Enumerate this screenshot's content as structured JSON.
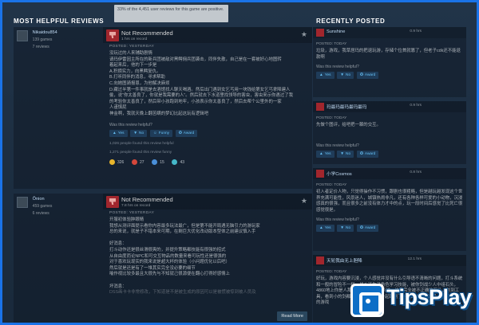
{
  "left_title": "MOST HELPFUL REVIEWS",
  "right_title": "RECENTLY POSTED",
  "tooltip": "33% of the 4,451 user reviews for this game are positive.",
  "reviews": [
    {
      "author": "Nikaidou854",
      "games": "139 games",
      "review_count": "7 reviews",
      "recommendation": "Not Recommended",
      "hours": "1 hrs on record",
      "posted": "POSTED: YESTERDAY",
      "lines": [
        "没玩过的人来辅助剧情",
        "请玛伊雷因主所在的新兵团被敌对黑鳄佣兵团袭击，同伴失散，自己是在一套被好心地图转",
        "着起来后，他的下一步是",
        "A.积攒实力，向黑鳄复仇。",
        "B.打听同伴的消息，寻求帮助",
        "C.向她图骑报恩，为他解决麻烦",
        "D.藏过半第一件事就是去酒馆找人聊天喝酒。然后出门遇到女乞丐用一块钱给第女乞丐拿降建人",
        "偷，说“你太善良了，你就是我需要的人”。然后就去下水道里找领导的害虫，害虫来示你遇过了我",
        "的考验你太善良了，然后带小孩跑到地牢，小孩表示你太善良了，然后去帮个公里外的一家",
        "人谨慎屁",
        "神金啊，我就天晚上翻苦瞒的梦幻比起这玩有逻辑吧"
      ],
      "helpful_q": "Was this review helpful?",
      "yes": "Yes",
      "no": "No",
      "funny": "Funny",
      "award": "Award",
      "helpful_count": "1,026 people found this review helpful",
      "funny_count": "1,271 people found this review funny",
      "awards": [
        "326",
        "27",
        "15",
        "43"
      ]
    },
    {
      "author": "Ônion",
      "games": "459 games",
      "review_count": "6 reviews",
      "recommendation": "Not Recommended",
      "hours": "7.8 hrs on record",
      "posted": "POSTED: YESTERDAY",
      "lines": [
        "开服初体验肿眼睛",
        "我想从测评面提示看你内容最多玩法最广，但是第不能开局遇无脑引力的游玩家",
        "总的来说，就是子不错本来可期，在剩巨大优化改动版本型体之前建议慎入手",
        "",
        "好消息：",
        "打斗动作还是很丝滑很爽的，并提升策略都技能有很强的招式",
        "从自由度而论NPC和可交互物品的数量来看可玩性还是很强的",
        "对于喜欢玩现实的我来说是超大杯的体验（小问题优化以后吧）",
        "然后就是还是有了一堆其实完全没必要的细节",
        "喻作视比较多最且大很先与不知就己很源便在翻心打得好感情上",
        "",
        "坏消息：",
        "DSS画卡卡非常修改，下知道是不是被生成的原因可以是被慌被惊到被人员及"
      ],
      "read_more": "Read More"
    }
  ],
  "recent": [
    {
      "name": "Sunshine",
      "hours": "0.9 hrs",
      "posted": "POSTED: TODAY",
      "text": "垃圾，游戏，我草居玛的把退玩游，存储个位首就篡了，但老子cdk还不能退款啊",
      "helpful_q": "Was this review helpful?",
      "yes": "Yes",
      "no": "No",
      "award": "Award"
    },
    {
      "name": "玛最玛最玛最玛最玛",
      "hours": "0.9 hrs",
      "posted": "POSTED: TODAY",
      "text": "先做个图评，给吧把一棘的交互。",
      "helpful_q": "Was this review helpful?",
      "yes": "Yes",
      "no": "No",
      "award": "Award"
    },
    {
      "name": "小学Cosmos",
      "hours": "0.8 hrs",
      "posted": "POSTED: TODAY",
      "text": "初入者定价人物，只觉得操作不习惯，跟剧也很粗略，但是越玩越发现这个世界充满可能性，风景迷人，城镇热闹非凡，还有各种各样可爱的小动物，沉浸感真的很强，而且很多之前没有体力才中的点，玩一段时间后感觉了比死亡很感觉很是。",
      "helpful_q": "Was this review helpful?",
      "yes": "Yes",
      "no": "No",
      "award": "Award"
    },
    {
      "name": "天轮我由无上胆降",
      "hours": "12.1 hrs",
      "posted": "POSTED: TODAY",
      "text": "好玩，游戏内容要沉浸，个人感觉并没有什么引导语不清晰的问题，打斗系统和一般的冒险不一样，战斗还为了角色学习技能，被你剑战少人中组石头，4860地上你是人那一中都花掉体的系统，结果完全被不正确的石头，剑到工具，看到小的剑都很好的，我们中一起跑到了对方的这样，选段一下可以最初的游戏",
      "helpful_q": "",
      "yes": "",
      "no": "",
      "award": ""
    }
  ],
  "logo_text": "TipsPlay",
  "colors": {
    "accent": "#66c0f4",
    "negative": "#a1262d",
    "frame": "#1a73e8"
  }
}
